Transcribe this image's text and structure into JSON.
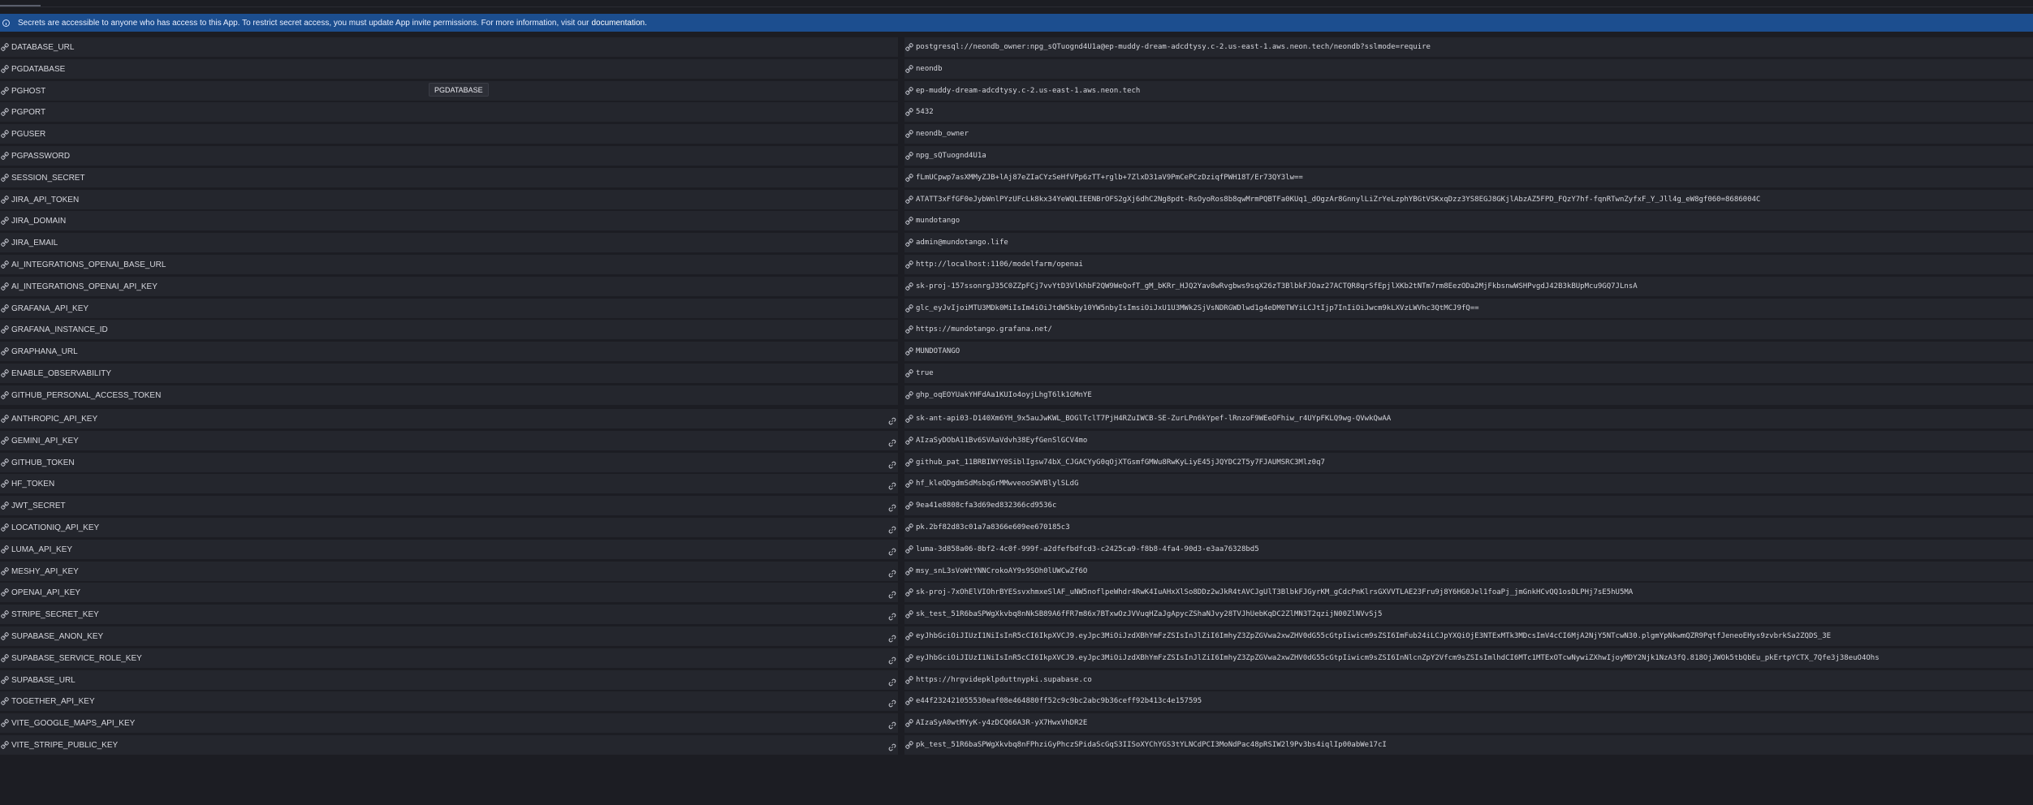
{
  "banner": {
    "text": "Secrets are accessible to anyone who has access to this App. To restrict secret access, you must update App invite permissions. For more information, visit our",
    "link": "documentation."
  },
  "tooltip": {
    "text": "PGDATABASE"
  },
  "icons": {
    "lock": "lock-icon",
    "link": "link-icon",
    "info": "info-icon"
  },
  "secrets": [
    {
      "key": "DATABASE_URL",
      "value": "postgresql://neondb_owner:npg_sQTuognd4U1a@ep-muddy-dream-adcdtysy.c-2.us-east-1.aws.neon.tech/neondb?sslmode=require"
    },
    {
      "key": "PGDATABASE",
      "value": "neondb"
    },
    {
      "key": "PGHOST",
      "value": "ep-muddy-dream-adcdtysy.c-2.us-east-1.aws.neon.tech"
    },
    {
      "key": "PGPORT",
      "value": "5432"
    },
    {
      "key": "PGUSER",
      "value": "neondb_owner"
    },
    {
      "key": "PGPASSWORD",
      "value": "npg_sQTuognd4U1a"
    },
    {
      "key": "SESSION_SECRET",
      "value": "fLmUCpwp7asXMMyZJB+lAj87eZIaCYzSeHfVPp6zTT+rglb+7ZlxD31aV9PmCePCzDziqfPWH18T/Er73QY3lw=="
    },
    {
      "key": "JIRA_API_TOKEN",
      "value": "ATATT3xFfGF0eJybWnlPYzUFcLk8kx34YeWQLIEENBrOFS2gXj6dhC2Ng8pdt-RsOyoRos8b8qwMrmPQBTFa0KUq1_dOgzAr8GnnylLiZrYeLzphYBGtVSKxqDzz3YS8EGJ8GKjlAbzAZ5FPD_FQzY7hf-fqnRTwnZyfxF_Y_Jll4g_eW8gf060=8686004C"
    },
    {
      "key": "JIRA_DOMAIN",
      "value": "mundotango"
    },
    {
      "key": "JIRA_EMAIL",
      "value": "admin@mundotango.life"
    },
    {
      "key": "AI_INTEGRATIONS_OPENAI_BASE_URL",
      "value": "http://localhost:1106/modelfarm/openai"
    },
    {
      "key": "AI_INTEGRATIONS_OPENAI_API_KEY",
      "value": "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"
    },
    {
      "key": "GRAFANA_API_KEY",
      "value": "glc_eyJvIjoiMTU3MDk0MiIsIm4iOiJtdW5kby10YW5nbyIsImsiOiJxU1U3MWk2SjVsNDRGWDlwd1g4eDM0TWYiLCJtIjp7InIiOiJwcm9kLXVzLWVhc3QtMCJ9fQ=="
    },
    {
      "key": "GRAFANA_INSTANCE_ID",
      "value": "https://mundotango.grafana.net/"
    },
    {
      "key": "GRAPHANA_URL",
      "value": "MUNDOTANGO"
    },
    {
      "key": "ENABLE_OBSERVABILITY",
      "value": "true"
    },
    {
      "key": "GITHUB_PERSONAL_ACCESS_TOKEN",
      "value": "ghp_oqEOYUakYHFdAa1KUIo4oyjLhgT6lk1GMnYE"
    }
  ],
  "linked_secrets": [
    {
      "key": "ANTHROPIC_API_KEY",
      "value": "sk-ant-api03-D140Xm6YH_9x5auJwKWL_BOGlTclT7PjH4RZuIWCB-SE-ZurLPn6kYpef-lRnzoF9WEeOFhiw_r4UYpFKLQ9wg-QVwkQwAA"
    },
    {
      "key": "GEMINI_API_KEY",
      "value": "AIzaSyDObA11Bv6SVAaVdvh38EyfGenSlGCV4mo"
    },
    {
      "key": "GITHUB_TOKEN",
      "value": "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"
    },
    {
      "key": "HF_TOKEN",
      "value": "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"
    },
    {
      "key": "JWT_SECRET",
      "value": "9ea41e8808cfa3d69ed832366cd9536c"
    },
    {
      "key": "LOCATIONIQ_API_KEY",
      "value": "pk.2bf82d83c01a7a8366e609ee670185c3"
    },
    {
      "key": "LUMA_API_KEY",
      "value": "luma-3d858a06-8bf2-4c0f-999f-a2dfefbdfcd3-c2425ca9-f8b8-4fa4-90d3-e3aa76328bd5"
    },
    {
      "key": "MESHY_API_KEY",
      "value": "msy_snL3sVoWtYNNCrokoAY9s9SOh0lUWCwZf6O"
    },
    {
      "key": "OPENAI_API_KEY",
      "value": "sk-proj-7xOhElVIOhrBYESsvxhmxeSlAF_uNW5noflpeWhdr4RwK4IuAHxXlSo8DDz2wJkR4tAVCJgUlT3BlbkFJGyrKM_gCdcPnKlrsGXVVTLAE23Fru9j8Y6HG0Jel1foaPj_jmGnkHCvQQ1osDLPHj7sE5hU5MA"
    },
    {
      "key": "STRIPE_SECRET_KEY",
      "value": "sk_test_51R6baSPWgXkvbq8nNkSB89A6fFR7m86x7BTxwOzJVVuqHZaJgApycZShaNJvy28TVJhUebKqDC2ZlMN3T2qzijN00ZlNVvSj5"
    },
    {
      "key": "SUPABASE_ANON_KEY",
      "value": "eyJhbGciOiJIUzI1NiIsInR5cCI6IkpXVCJ9.eyJpc3MiOiJzdXBhYmFzZSIsInJlZiI6ImhyZ3ZpZGVwa2xwZHV0dG55cGtpIiwicm9sZSI6ImFub24iLCJpYXQiOjE3NTExMTk3MDcsImV4cCI6MjA2NjY5NTcwN30.plgmYpNkwmQZR9PqtfJeneoEHys9zvbrkSa2ZQDS_3E"
    },
    {
      "key": "SUPABASE_SERVICE_ROLE_KEY",
      "value": "eyJhbGciOiJIUzI1NiIsInR5cCI6IkpXVCJ9.eyJpc3MiOiJzdXBhYmFzZSIsInJlZiI6ImhyZ3ZpZGVwa2xwZHV0dG55cGtpIiwicm9sZSI6InNlcnZpY2Vfcm9sZSIsImlhdCI6MTc1MTExOTcwNywiZXhwIjoyMDY2Njk1NzA3fQ.818OjJWOk5tbQbEu_pkErtpYCTX_7Qfe3j38euO4Ohs"
    },
    {
      "key": "SUPABASE_URL",
      "value": "https://hrgvidepklpduttnypki.supabase.co"
    },
    {
      "key": "TOGETHER_API_KEY",
      "value": "e44f232421055530eaf08e464880ff52c9c9bc2abc9b36ceff92b413c4e157595"
    },
    {
      "key": "VITE_GOOGLE_MAPS_API_KEY",
      "value": "AIzaSyA0wtMYyK-y4zDCQ66A3R-yX7HwxVhDR2E"
    },
    {
      "key": "VITE_STRIPE_PUBLIC_KEY",
      "value": "pk_test_51R6baSPWgXkvbq8nFPhziGyPhczSPidaScGqS3IISoXYChYGS3tYLNCdPCI3MoNdPac48pRSIW2l9Pv3bs4iqlIp00abWe17cI"
    }
  ]
}
